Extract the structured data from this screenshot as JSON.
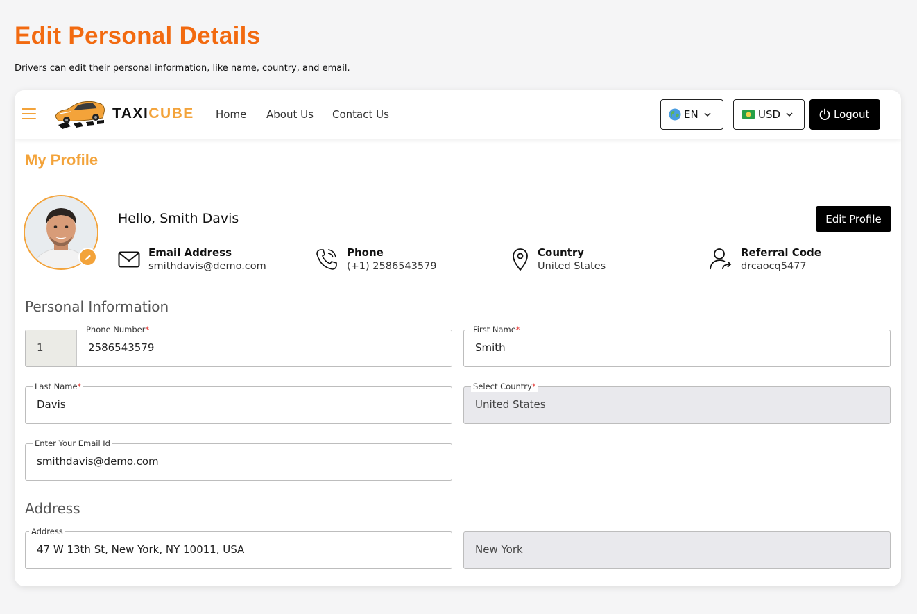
{
  "page": {
    "title": "Edit Personal Details",
    "subtitle": "Drivers can edit their personal information, like name, country, and email."
  },
  "nav": {
    "brand_part1": "TAXI",
    "brand_part2": "CUBE",
    "links": [
      "Home",
      "About Us",
      "Contact Us"
    ],
    "language": "EN",
    "currency": "USD",
    "logout": "Logout"
  },
  "profile": {
    "heading": "My Profile",
    "greeting": "Hello, Smith Davis",
    "edit_button": "Edit Profile",
    "info": [
      {
        "label": "Email Address",
        "value": "smithdavis@demo.com",
        "icon": "mail-icon"
      },
      {
        "label": "Phone",
        "value": "(+1) 2586543579",
        "icon": "phone-icon"
      },
      {
        "label": "Country",
        "value": "United States",
        "icon": "location-pin-icon"
      },
      {
        "label": "Referral Code",
        "value": "drcaocq5477",
        "icon": "user-share-icon"
      }
    ]
  },
  "personal": {
    "heading": "Personal Information",
    "phone_code": "1",
    "phone_label": "Phone Number",
    "phone_value": "2586543579",
    "first_name_label": "First Name",
    "first_name_value": "Smith",
    "last_name_label": "Last Name",
    "last_name_value": "Davis",
    "country_label": "Select Country",
    "country_value": "United States",
    "email_label": "Enter Your Email Id",
    "email_value": "smithdavis@demo.com"
  },
  "address": {
    "heading": "Address",
    "address_label": "Address",
    "address_value": "47 W 13th St, New York, NY 10011, USA",
    "city_value": "New York"
  },
  "colors": {
    "title_orange": "#f26a10",
    "accent": "#f3a33a",
    "button_black": "#000000",
    "readonly_grey": "#e9e9ed"
  }
}
